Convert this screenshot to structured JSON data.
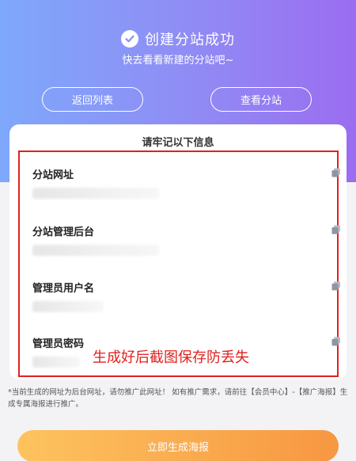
{
  "hero": {
    "title": "创建分站成功",
    "subtitle": "快去看看新建的分站吧~",
    "back_label": "返回列表",
    "view_label": "查看分站"
  },
  "card": {
    "title": "请牢记以下信息",
    "items": [
      {
        "label": "分站网址",
        "icon": "copy-icon"
      },
      {
        "label": "分站管理后台",
        "icon": "copy-icon"
      },
      {
        "label": "管理员用户名",
        "icon": "copy-icon"
      },
      {
        "label": "管理员密码",
        "icon": "copy-icon"
      }
    ],
    "overlay_text": "生成好后截图保存防丢失"
  },
  "notice": "*当前生成的网址为后台网址，请勿推广此网址！ 如有推广需求，请前往【会员中心】-【推广海报】生成专属海报进行推广。",
  "poster_button": "立即生成海报",
  "colors": {
    "gradient_start": "#7ea8fb",
    "gradient_end": "#9b6df1",
    "highlight": "#e0211e",
    "button_start": "#fdc35f",
    "button_end": "#f79741"
  }
}
